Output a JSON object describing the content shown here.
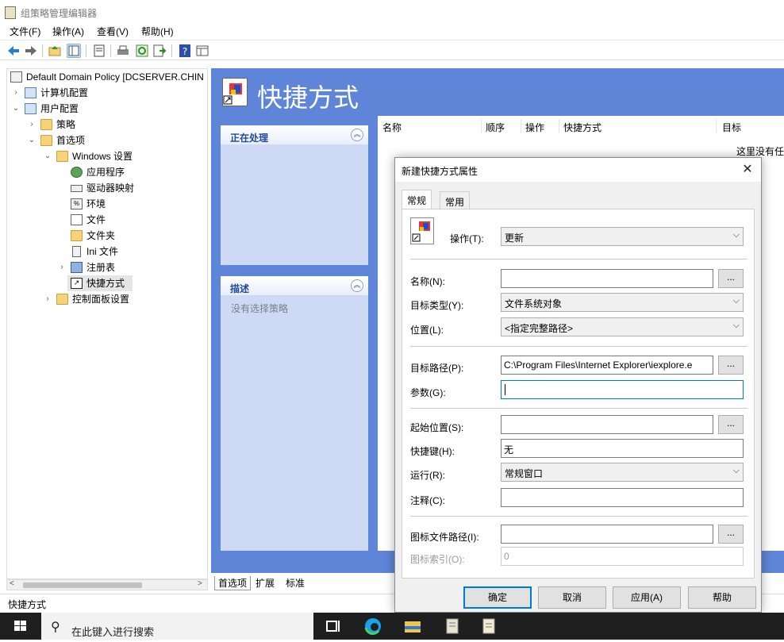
{
  "window": {
    "title": "组策略管理编辑器"
  },
  "menu": [
    "文件(F)",
    "操作(A)",
    "查看(V)",
    "帮助(H)"
  ],
  "toolbar": [
    "back-icon",
    "forward-icon",
    "up-folder-icon",
    "show-hide-tree-icon",
    "properties-icon",
    "print-icon",
    "refresh-icon",
    "export-icon",
    "help-icon",
    "view-icon"
  ],
  "tree": {
    "root": "Default Domain Policy [DCSERVER.CHIN",
    "items": [
      {
        "label": "计算机配置",
        "level": 1,
        "caret": "›"
      },
      {
        "label": "用户配置",
        "level": 1,
        "caret": "⌄"
      },
      {
        "label": "策略",
        "level": 2,
        "caret": "›"
      },
      {
        "label": "首选项",
        "level": 2,
        "caret": "⌄"
      },
      {
        "label": "Windows 设置",
        "level": 3,
        "caret": "⌄"
      },
      {
        "label": "应用程序",
        "level": 4,
        "caret": ""
      },
      {
        "label": "驱动器映射",
        "level": 4,
        "caret": ""
      },
      {
        "label": "环境",
        "level": 4,
        "caret": ""
      },
      {
        "label": "文件",
        "level": 4,
        "caret": ""
      },
      {
        "label": "文件夹",
        "level": 4,
        "caret": ""
      },
      {
        "label": "Ini 文件",
        "level": 4,
        "caret": ""
      },
      {
        "label": "注册表",
        "level": 4,
        "caret": "›"
      },
      {
        "label": "快捷方式",
        "level": 4,
        "caret": ""
      },
      {
        "label": "控制面板设置",
        "level": 3,
        "caret": "›"
      }
    ]
  },
  "right": {
    "title": "快捷方式",
    "panel_processing": "正在处理",
    "panel_description": "描述",
    "description_text": "没有选择策略",
    "columns": [
      "名称",
      "顺序",
      "操作",
      "快捷方式",
      "目标"
    ],
    "empty_text": "这里没有任"
  },
  "bottom_tabs": [
    "首选项",
    "扩展",
    "标准"
  ],
  "status": "快捷方式",
  "dialog": {
    "title": "新建快捷方式属性",
    "close": "✕",
    "tabs": [
      "常规",
      "常用"
    ],
    "action_label": "操作(T):",
    "action_value": "更新",
    "name_label": "名称(N):",
    "name_value": "",
    "target_type_label": "目标类型(Y):",
    "target_type_value": "文件系统对象",
    "location_label": "位置(L):",
    "location_value": "<指定完整路径>",
    "target_path_label": "目标路径(P):",
    "target_path_value": "C:\\Program Files\\Internet Explorer\\iexplore.e",
    "args_label": "参数(G):",
    "args_value": "",
    "start_in_label": "起始位置(S):",
    "start_in_value": "",
    "hotkey_label": "快捷键(H):",
    "hotkey_value": "无",
    "run_label": "运行(R):",
    "run_value": "常规窗口",
    "comment_label": "注释(C):",
    "comment_value": "",
    "icon_path_label": "图标文件路径(I):",
    "icon_path_value": "",
    "icon_index_label": "图标索引(O):",
    "icon_index_value": "0",
    "browse": "...",
    "buttons": {
      "ok": "确定",
      "cancel": "取消",
      "apply": "应用(A)",
      "help": "帮助"
    }
  },
  "taskbar": {
    "search_placeholder": "在此键入进行搜索",
    "icons": [
      "task-view-icon",
      "edge-icon",
      "file-explorer-icon",
      "gpme-icon",
      "notepad-icon"
    ]
  },
  "colors": {
    "pane_blue": "#5f85d8",
    "panel_bg": "#ced9f5",
    "accent": "#0078d7",
    "taskbar": "#1f1f1f"
  }
}
